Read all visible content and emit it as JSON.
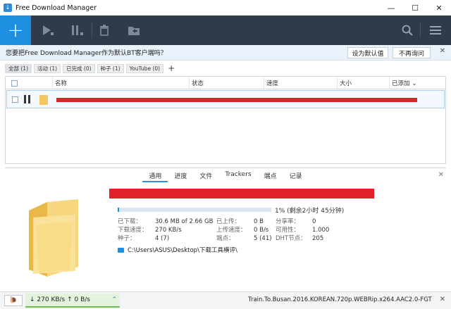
{
  "window": {
    "title": "Free Download Manager",
    "minimize": "—",
    "maximize": "☐",
    "close": "✕"
  },
  "toolbar": {
    "add": "+",
    "icons": [
      "play-icon",
      "pause-all-icon",
      "delete-icon",
      "move-icon",
      "search-icon",
      "menu-icon"
    ],
    "accent": "#1e8fe0",
    "background": "#2f3b4a"
  },
  "bt_prompt": {
    "message": "您要把Free Download Manager作为默认BT客户端吗？",
    "set_default": "设为默认值",
    "dont_ask": "不再询问",
    "close": "✕"
  },
  "filters": {
    "items": [
      "全部 (1)",
      "活动 (1)",
      "已完成 (0)",
      "种子 (1)",
      "YouTube (0)"
    ],
    "add": "+"
  },
  "list": {
    "columns": [
      "名称",
      "状态",
      "速度",
      "大小",
      "已添加 ⌄"
    ],
    "rows": [
      {
        "name": "",
        "status": "",
        "speed": "",
        "size": ""
      }
    ]
  },
  "details": {
    "tabs": [
      "通用",
      "进度",
      "文件",
      "Trackers",
      "端点",
      "记录"
    ],
    "active_tab": "通用",
    "close": "✕",
    "progress_percent": 1,
    "progress_label": "1% (剩余2小时 45分钟)",
    "stats": {
      "downloaded_label": "已下载：",
      "downloaded": "30.6 MB of 2.66 GB",
      "dl_speed_label": "下载速度：",
      "dl_speed": "270 KB/s",
      "seeds_label": "种子：",
      "seeds": "4 (7)",
      "uploaded_label": "已上传：",
      "uploaded": "0 B",
      "ul_speed_label": "上传速度：",
      "ul_speed": "0 B/s",
      "peers_label": "端点：",
      "peers": "5 (41)",
      "ratio_label": "分享率：",
      "ratio": "0",
      "availability_label": "可用性：",
      "availability": "1.000",
      "dht_label": "DHT节点：",
      "dht": "205"
    },
    "path": "C:\\Users\\ASUS\\Desktop\\下载工具横评\\"
  },
  "statusbar": {
    "snail": "🐌",
    "speed": "↓ 270 KB/s ↑ 0 B/s",
    "chevron": "⌃",
    "file": "Train.To.Busan.2016.KOREAN.720p.WEBRip.x264.AAC2.0-FGT",
    "close": "✕"
  }
}
